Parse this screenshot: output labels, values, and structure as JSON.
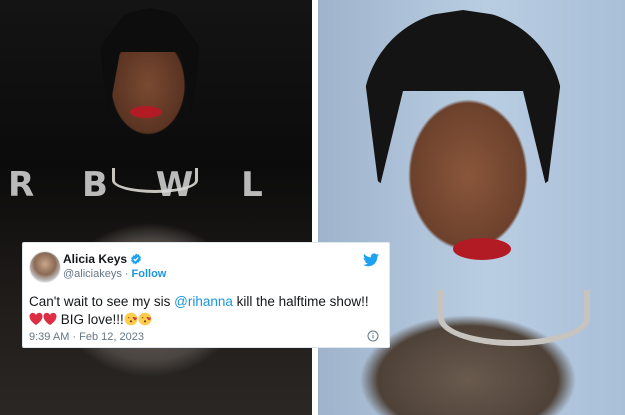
{
  "left_photo": {
    "stage_text": "R  B  W  L"
  },
  "tweet": {
    "display_name": "Alicia Keys",
    "handle": "@aliciakeys",
    "separator": "·",
    "follow_label": "Follow",
    "body": {
      "text_before": "Can't wait to see my sis ",
      "mention": "@rihanna",
      "text_after": " kill the halftime show!!",
      "line2_text": " BIG love!!!"
    },
    "timestamp": "9:39 AM · Feb 12, 2023",
    "icons": [
      "verified-badge-icon",
      "twitter-bird-icon",
      "info-icon",
      "red-heart-icon",
      "kiss-face-icon"
    ]
  },
  "colors": {
    "link": "#1b95e0",
    "verified": "#1da1f2",
    "text": "#14171a",
    "muted": "#657786",
    "lipstick": "#b31b24"
  }
}
